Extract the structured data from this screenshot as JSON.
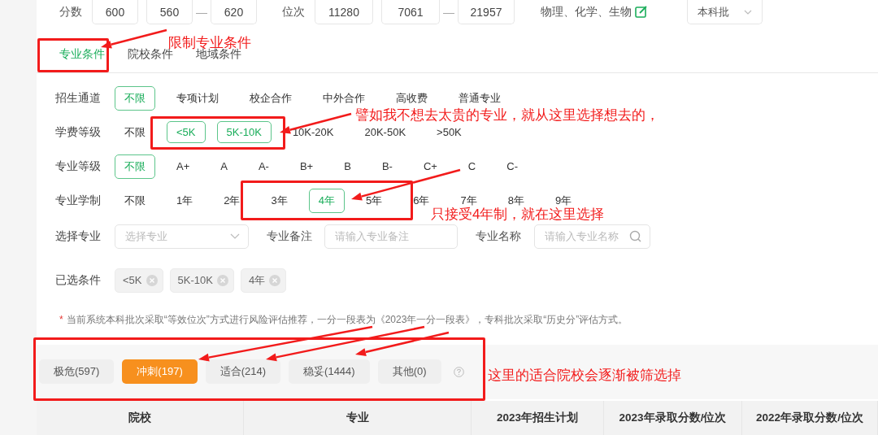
{
  "score": {
    "label": "分数",
    "values": [
      "600",
      "560",
      "620"
    ],
    "separator": "—"
  },
  "rank": {
    "label": "位次",
    "values": [
      "11280",
      "7061",
      "21957"
    ],
    "separator": "—"
  },
  "subjects": "物理、化学、生物",
  "batch": {
    "value": "本科批"
  },
  "tabs": [
    {
      "label": "专业条件",
      "selected": true
    },
    {
      "label": "院校条件",
      "selected": false
    },
    {
      "label": "地域条件",
      "selected": false
    }
  ],
  "filter_rows": [
    {
      "label": "招生通道",
      "options": [
        {
          "label": "不限",
          "selected": true
        },
        {
          "label": "专项计划",
          "selected": false
        },
        {
          "label": "校企合作",
          "selected": false
        },
        {
          "label": "中外合作",
          "selected": false
        },
        {
          "label": "高收费",
          "selected": false
        },
        {
          "label": "普通专业",
          "selected": false
        }
      ]
    },
    {
      "label": "学费等级",
      "options": [
        {
          "label": "不限",
          "selected": false
        },
        {
          "label": "<5K",
          "selected": true
        },
        {
          "label": "5K-10K",
          "selected": true
        },
        {
          "label": "10K-20K",
          "selected": false
        },
        {
          "label": "20K-50K",
          "selected": false
        },
        {
          "label": ">50K",
          "selected": false
        }
      ]
    },
    {
      "label": "专业等级",
      "options": [
        {
          "label": "不限",
          "selected": true
        },
        {
          "label": "A+",
          "selected": false
        },
        {
          "label": "A",
          "selected": false
        },
        {
          "label": "A-",
          "selected": false
        },
        {
          "label": "B+",
          "selected": false
        },
        {
          "label": "B",
          "selected": false
        },
        {
          "label": "B-",
          "selected": false
        },
        {
          "label": "C+",
          "selected": false
        },
        {
          "label": "C",
          "selected": false
        },
        {
          "label": "C-",
          "selected": false
        }
      ]
    },
    {
      "label": "专业学制",
      "options": [
        {
          "label": "不限",
          "selected": false
        },
        {
          "label": "1年",
          "selected": false
        },
        {
          "label": "2年",
          "selected": false
        },
        {
          "label": "3年",
          "selected": false
        },
        {
          "label": "4年",
          "selected": true
        },
        {
          "label": "5年",
          "selected": false
        },
        {
          "label": "6年",
          "selected": false
        },
        {
          "label": "7年",
          "selected": false
        },
        {
          "label": "8年",
          "selected": false
        },
        {
          "label": "9年",
          "selected": false
        }
      ]
    }
  ],
  "search_row": {
    "major_select": {
      "label": "选择专业",
      "placeholder": "选择专业"
    },
    "note_field": {
      "label": "专业备注",
      "placeholder": "请输入专业备注"
    },
    "name_field": {
      "label": "专业名称",
      "placeholder": "请输入专业名称"
    }
  },
  "selected_conditions": {
    "label": "已选条件",
    "tags": [
      "<5K",
      "5K-10K",
      "4年"
    ]
  },
  "notice": {
    "mark": "*",
    "text": "当前系统本科批次采取“等效位次”方式进行风险评估推荐，一分一段表为《2023年一分一段表》，专科批次采取“历史分”评估方式。"
  },
  "risk_tabs": [
    {
      "label": "极危(597)",
      "selected": false
    },
    {
      "label": "冲刺(197)",
      "selected": true
    },
    {
      "label": "适合(214)",
      "selected": false
    },
    {
      "label": "稳妥(1444)",
      "selected": false
    },
    {
      "label": "其他(0)",
      "selected": false
    }
  ],
  "table": {
    "columns": [
      "院校",
      "专业",
      "2023年招生计划",
      "2023年录取分数/位次",
      "2022年录取分数/位次"
    ]
  },
  "annotations": [
    {
      "text": "限制专业条件"
    },
    {
      "text": "譬如我不想去太贵的专业，就从这里选择想去的，"
    },
    {
      "text": "只接受4年制，就在这里选择"
    },
    {
      "text": "这里的适合院校会逐渐被筛选掉"
    }
  ]
}
